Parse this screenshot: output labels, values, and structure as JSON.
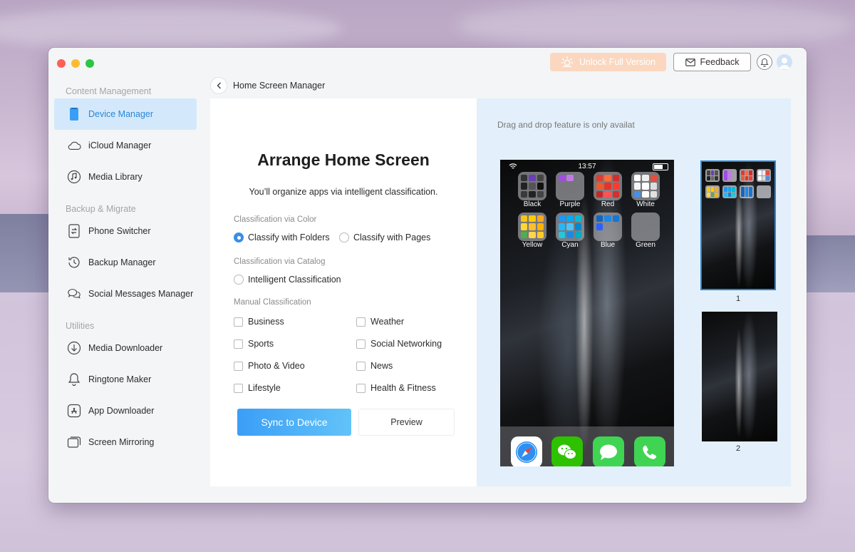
{
  "window": {
    "unlock_label": "Unlock Full Version",
    "feedback_label": "Feedback",
    "page_title": "Home Screen Manager"
  },
  "sidebar": {
    "sections": [
      {
        "title": "Content Management"
      },
      {
        "title": "Backup & Migrate"
      },
      {
        "title": "Utilities"
      }
    ],
    "items": [
      {
        "label": "Device Manager",
        "icon": "device-icon",
        "active": true
      },
      {
        "label": "iCloud Manager",
        "icon": "cloud-icon"
      },
      {
        "label": "Media Library",
        "icon": "music-icon"
      },
      {
        "label": "Phone Switcher",
        "icon": "phone-switch-icon"
      },
      {
        "label": "Backup Manager",
        "icon": "clock-history-icon"
      },
      {
        "label": "Social Messages Manager",
        "icon": "chat-bubbles-icon"
      },
      {
        "label": "Media Downloader",
        "icon": "download-icon"
      },
      {
        "label": "Ringtone Maker",
        "icon": "bell-icon"
      },
      {
        "label": "App Downloader",
        "icon": "app-store-icon"
      },
      {
        "label": "Screen Mirroring",
        "icon": "mirror-icon"
      }
    ]
  },
  "arrange": {
    "heading": "Arrange Home Screen",
    "subtitle": "You’ll organize apps via intelligent classification.",
    "color_group": "Classification via Color",
    "folders_option": "Classify with Folders",
    "pages_option": "Classify with Pages",
    "catalog_group": "Classification via Catalog",
    "intelligent_option": "Intelligent Classification",
    "manual_group": "Manual Classification",
    "categories": [
      {
        "label": "Business",
        "checked": false
      },
      {
        "label": "Weather",
        "checked": false
      },
      {
        "label": "Sports",
        "checked": false
      },
      {
        "label": "Social Networking",
        "checked": false
      },
      {
        "label": "Photo & Video",
        "checked": false
      },
      {
        "label": "News",
        "checked": false
      },
      {
        "label": "Lifestyle",
        "checked": false
      },
      {
        "label": "Health & Fitness",
        "checked": false
      }
    ],
    "sync_label": "Sync to Device",
    "preview_label": "Preview"
  },
  "preview": {
    "drag_note": "Drag and drop feature is only availat",
    "time": "13:57",
    "folders": [
      "Black",
      "Purple",
      "Red",
      "White",
      "Yellow",
      "Cyan",
      "Blue",
      "Green"
    ],
    "pages": [
      "1",
      "2"
    ]
  },
  "colors": {
    "accent": "#2b86d6",
    "active_bg": "#d3e9fb",
    "unlock_bg": "#fbd7c0",
    "sync_start": "#3b9ef6",
    "sync_end": "#62c3f8"
  }
}
